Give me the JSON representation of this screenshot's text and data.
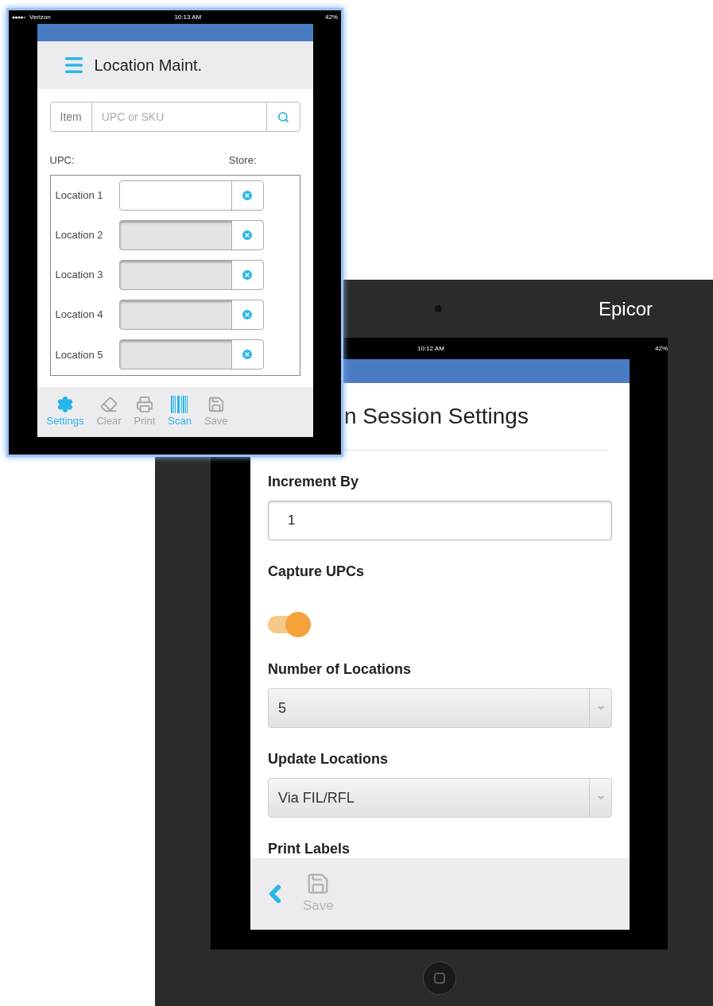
{
  "back_device": {
    "brand": "Epicor",
    "status_bar": {
      "time": "10:12 AM",
      "battery": "42%"
    },
    "screen": {
      "title": "n Session Settings",
      "fields": [
        {
          "kind": "text",
          "label": "Increment By",
          "value": "1"
        },
        {
          "kind": "toggle",
          "label": "Capture UPCs",
          "on": true
        },
        {
          "kind": "select",
          "label": "Number of Locations",
          "value": "5"
        },
        {
          "kind": "select",
          "label": "Update Locations",
          "value": "Via FIL/RFL"
        },
        {
          "kind": "heading",
          "label": "Print Labels"
        }
      ],
      "toolbar": [
        {
          "kind": "back"
        },
        {
          "kind": "save",
          "label": "Save",
          "disabled": true
        }
      ]
    }
  },
  "front_device": {
    "status_bar": {
      "carrier": "Verizon",
      "time": "10:13 AM",
      "battery": "42%"
    },
    "screen": {
      "title": "Location Maint.",
      "search": {
        "addon": "Item",
        "placeholder": "UPC or SKU"
      },
      "upc_label": "UPC:",
      "store_label": "Store:",
      "locations": [
        {
          "label": "Location 1",
          "disabled": false
        },
        {
          "label": "Location 2",
          "disabled": true
        },
        {
          "label": "Location 3",
          "disabled": true
        },
        {
          "label": "Location 4",
          "disabled": true
        },
        {
          "label": "Location 5",
          "disabled": true
        }
      ],
      "toolbar": [
        {
          "kind": "settings",
          "label": "Settings",
          "active": true
        },
        {
          "kind": "clear",
          "label": "Clear",
          "active": false
        },
        {
          "kind": "print",
          "label": "Print",
          "active": false
        },
        {
          "kind": "scan",
          "label": "Scan",
          "active": true
        },
        {
          "kind": "save",
          "label": "Save",
          "active": false
        }
      ]
    }
  }
}
